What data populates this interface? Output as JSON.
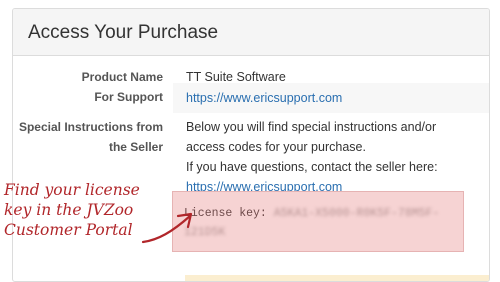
{
  "panel": {
    "title": "Access Your Purchase"
  },
  "rows": [
    {
      "label": "Product Name",
      "value": "TT Suite Software"
    },
    {
      "label": "For Support",
      "link": "https://www.ericsupport.com"
    },
    {
      "label_line1": "Special Instructions from",
      "label_line2": "the Seller",
      "text1": "Below you will find special instructions and/or access codes for your purchase.",
      "text2": "If you have questions, contact the seller here:",
      "link": "https://www.ericsupport.com"
    }
  ],
  "license": {
    "label": "License key:",
    "value_line1": "A5KA1-X5000-R0K5F-78M5F-",
    "value_line2": "121D5K"
  },
  "annotation": {
    "line1": "Find your license",
    "line2": "key in the JVZoo",
    "line3": "Customer Portal",
    "color": "#b1262a"
  },
  "colors": {
    "header_bg": "#f5f5f5",
    "link": "#2a6fb0",
    "license_bg": "#f6d3d3"
  }
}
